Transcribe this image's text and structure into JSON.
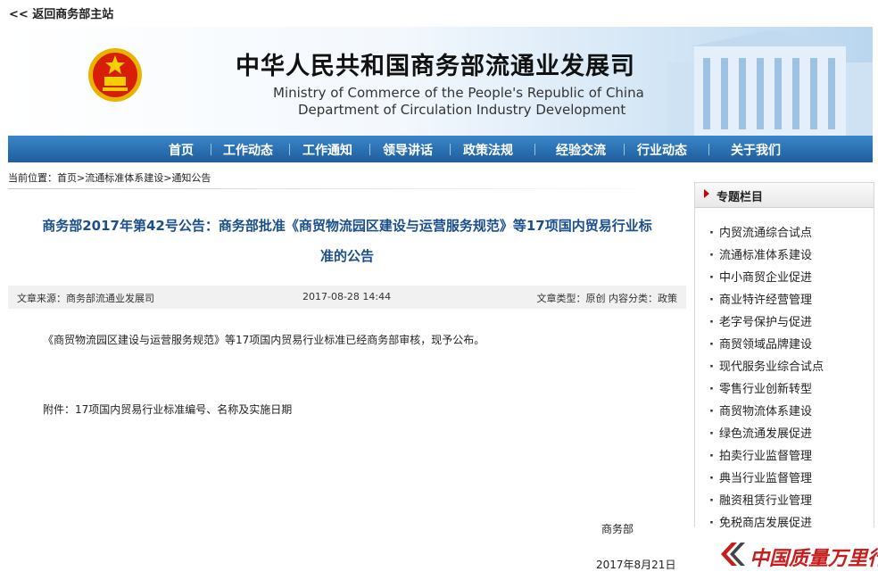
{
  "back_link": "<< 返回商务部主站",
  "header": {
    "title_cn": "中华人民共和国商务部流通业发展司",
    "title_en_1": "Ministry of Commerce of the People's Republic of China",
    "title_en_2": "Department of Circulation Industry Development"
  },
  "nav": [
    "首页",
    "工作动态",
    "工作通知",
    "领导讲话",
    "政策法规",
    "经验交流",
    "行业动态",
    "关于我们"
  ],
  "breadcrumb": {
    "label": "当前位置：",
    "items": [
      "首页",
      "流通标准体系建设",
      "通知公告"
    ],
    "sep": ">"
  },
  "article": {
    "title_line1": "商务部2017年第42号公告：商务部批准《商贸物流园区建设与运营服务规范》等17项国内贸易行业标",
    "title_line2": "准的公告",
    "source": "文章来源：商务部流通业发展司",
    "date": "2017-08-28 14:44",
    "type": "文章类型：原创 内容分类：政策",
    "body": "《商贸物流园区建设与运营服务规范》等17项国内贸易行业标准已经商务部审核，现予公布。",
    "attachment": "附件：17项国内贸易行业标准编号、名称及实施日期",
    "signature": "商务部",
    "sign_date": "2017年8月21日"
  },
  "sidebar": {
    "title": "专题栏目",
    "items": [
      "内贸流通综合试点",
      "流通标准体系建设",
      "中小商贸企业促进",
      "商业特许经营管理",
      "老字号保护与促进",
      "商贸领域品牌建设",
      "现代服务业综合试点",
      "零售行业创新转型",
      "商贸物流体系建设",
      "绿色流通发展促进",
      "拍卖行业监督管理",
      "典当行业监督管理",
      "融资租赁行业管理",
      "免税商店发展促进"
    ]
  },
  "watermark": {
    "text": "中国质量万里行"
  },
  "colors": {
    "nav": "#1d5e9e",
    "title": "#1a4f8a",
    "watermark": "#c81d1d",
    "emblem": "#d81e06"
  }
}
